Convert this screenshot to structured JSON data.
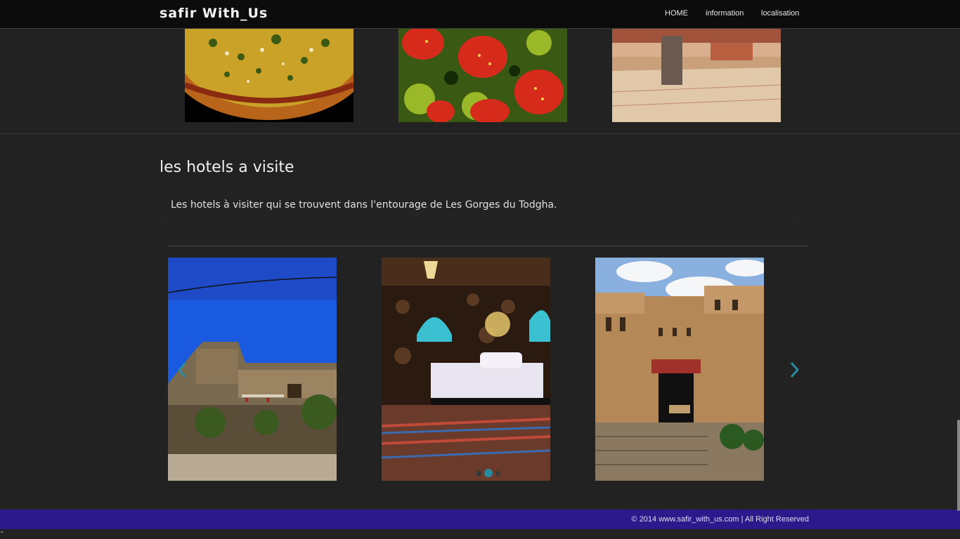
{
  "navbar": {
    "brand": "safir With_Us",
    "items": [
      {
        "label": "HOME"
      },
      {
        "label": "information"
      },
      {
        "label": "localisation"
      }
    ]
  },
  "gallery_top": {
    "images": [
      "food-tajine-image",
      "strawberry-salad-image",
      "hotel-interior-image"
    ]
  },
  "section": {
    "title": "les hotels a visite",
    "description": "Les hotels à visiter qui se trouvent dans l'entourage de Les Gorges du Todgha."
  },
  "carousel": {
    "images": [
      "stone-hotel-image",
      "moroccan-bedroom-image",
      "kasbah-entrance-image"
    ],
    "active_index": 1,
    "indicator_count": 3,
    "accent_color": "#2a8aa0"
  },
  "footer": {
    "text": "© 2014 www.safir_with_us.com | All Right Reserved",
    "color": "#2c1a8c"
  },
  "stray_text": "\""
}
